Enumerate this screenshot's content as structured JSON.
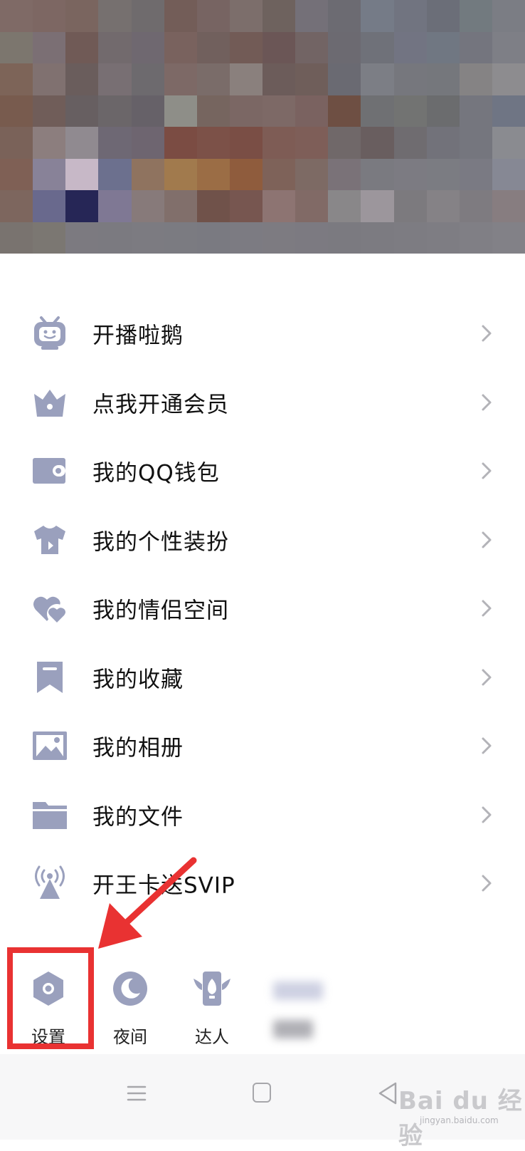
{
  "header": {
    "mosaic_colors": [
      "#7f6a66",
      "#7d6763",
      "#7a655f",
      "#76706f",
      "#6f6b6d",
      "#735d58",
      "#776462",
      "#7c6e6b",
      "#6e625e",
      "#747078",
      "#6c6b72",
      "#757b87",
      "#717480",
      "#6b6e78",
      "#727a7f",
      "#7b7d84",
      "#7c766e",
      "#7b6f74",
      "#705a56",
      "#726a6d",
      "#6f6870",
      "#79625e",
      "#71605d",
      "#725b56",
      "#6b5656",
      "#726464",
      "#6c6a71",
      "#6f7179",
      "#727482",
      "#707782",
      "#74757e",
      "#7e7f86",
      "#7d6458",
      "#807170",
      "#6a5d5c",
      "#786f73",
      "#6d6a6e",
      "#7d6966",
      "#7a6c69",
      "#8a807d",
      "#6c5c5a",
      "#6f5e5a",
      "#6a6a72",
      "#7c7e85",
      "#76777d",
      "#75777c",
      "#858384",
      "#8d8c8f",
      "#785b4e",
      "#705d59",
      "#675f61",
      "#6b6669",
      "#666168",
      "#8e8e88",
      "#76655f",
      "#7b6764",
      "#7d6966",
      "#7a6260",
      "#6e4f43",
      "#6f7073",
      "#727372",
      "#6b6c6e",
      "#75767e",
      "#6f7584",
      "#7a6259",
      "#8c7e7e",
      "#908a90",
      "#6e6874",
      "#6e6570",
      "#7b4c43",
      "#7c5148",
      "#7a4e45",
      "#7e5c55",
      "#7e5e58",
      "#706869",
      "#695e5f",
      "#6f6c70",
      "#72727a",
      "#75767e",
      "#8a8b90",
      "#7f6055",
      "#888298",
      "#c7b8c7",
      "#6c708e",
      "#8f735f",
      "#a17a4d",
      "#9b6d45",
      "#8f5c3d",
      "#7e6259",
      "#7d6a64",
      "#7a7278",
      "#7a7a80",
      "#7c7b82",
      "#7b7c82",
      "#7a7a83",
      "#868894",
      "#7d665e",
      "#69698d",
      "#262656",
      "#7f7894",
      "#877a7a",
      "#816f6b",
      "#70524a",
      "#775650",
      "#8d7472",
      "#816a66",
      "#898789",
      "#9c969c",
      "#7c7a7e",
      "#858286",
      "#7e7b80",
      "#877d80",
      "#79736f",
      "#7b7772",
      "#7c7a80",
      "#7b7a80",
      "#7c7b81",
      "#7b7b81",
      "#7a7a81",
      "#7c7b82",
      "#7d7b81",
      "#7c7a81",
      "#7b7a80",
      "#7c7b81",
      "#7d7c82",
      "#7e7d83",
      "#807f85",
      "#828187"
    ]
  },
  "menu": {
    "items": [
      {
        "label": "开播啦鹅",
        "icon": "tv-robot-icon"
      },
      {
        "label": "点我开通会员",
        "icon": "crown-icon"
      },
      {
        "label": "我的QQ钱包",
        "icon": "wallet-icon"
      },
      {
        "label": "我的个性装扮",
        "icon": "shirt-icon"
      },
      {
        "label": "我的情侣空间",
        "icon": "hearts-icon"
      },
      {
        "label": "我的收藏",
        "icon": "bookmark-icon"
      },
      {
        "label": "我的相册",
        "icon": "photo-icon"
      },
      {
        "label": "我的文件",
        "icon": "folder-icon"
      },
      {
        "label": "开王卡送SVIP",
        "icon": "broadcast-tower-icon"
      }
    ],
    "icon_color": "#9aa0bd",
    "chevron_color": "#b3b3b8"
  },
  "bottom_bar": {
    "settings_label": "设置",
    "night_label": "夜间",
    "expert_label": "达人"
  },
  "annotation": {
    "color": "#e93232"
  },
  "watermark": {
    "text": "Bai du 经验",
    "sub": "jingyan.baidu.com"
  }
}
